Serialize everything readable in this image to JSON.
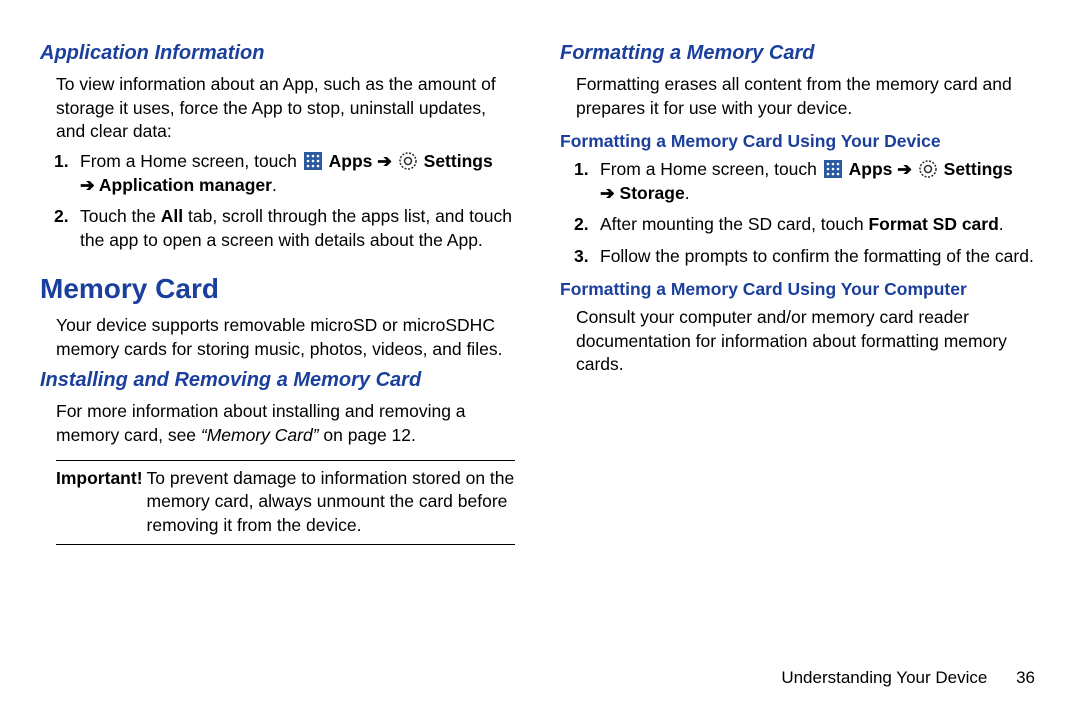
{
  "left": {
    "app_info_h": "Application Information",
    "app_info_p": "To view information about an App, such as the amount of storage it uses, force the App to stop, uninstall updates, and clear data:",
    "step1_a": "From a Home screen, touch ",
    "apps": "Apps",
    "settings": "Settings",
    "step1_b": "Application manager",
    "step2_a": "Touch the ",
    "step2_all": "All",
    "step2_b": " tab, scroll through the apps list, and touch the app to open a screen with details about the App.",
    "mem_h": "Memory Card",
    "mem_p": "Your device supports removable microSD or microSDHC memory cards for storing music, photos, videos, and files.",
    "inst_h": "Installing and Removing a Memory Card",
    "inst_p_a": "For more information about installing and removing a memory card, see ",
    "inst_p_i": "“Memory Card”",
    "inst_p_b": " on page 12.",
    "imp_label": "Important!",
    "imp_body": "To prevent damage to information stored on the memory card, always unmount the card before removing it from the device."
  },
  "right": {
    "fmt_h": "Formatting a Memory Card",
    "fmt_p": "Formatting erases all content from the memory card and prepares it for use with your device.",
    "fmt_dev_h": "Formatting a Memory Card Using Your Device",
    "step1_a": "From a Home screen, touch ",
    "apps": "Apps",
    "settings": "Settings",
    "storage": "Storage",
    "step2_a": "After mounting the SD card, touch ",
    "step2_b": "Format SD card",
    "step3": "Follow the prompts to confirm the formatting of the card.",
    "fmt_comp_h": "Formatting a Memory Card Using Your Computer",
    "fmt_comp_p": "Consult your computer and/or memory card reader documentation for information about formatting memory cards."
  },
  "footer": {
    "section": "Understanding Your Device",
    "page": "36"
  }
}
